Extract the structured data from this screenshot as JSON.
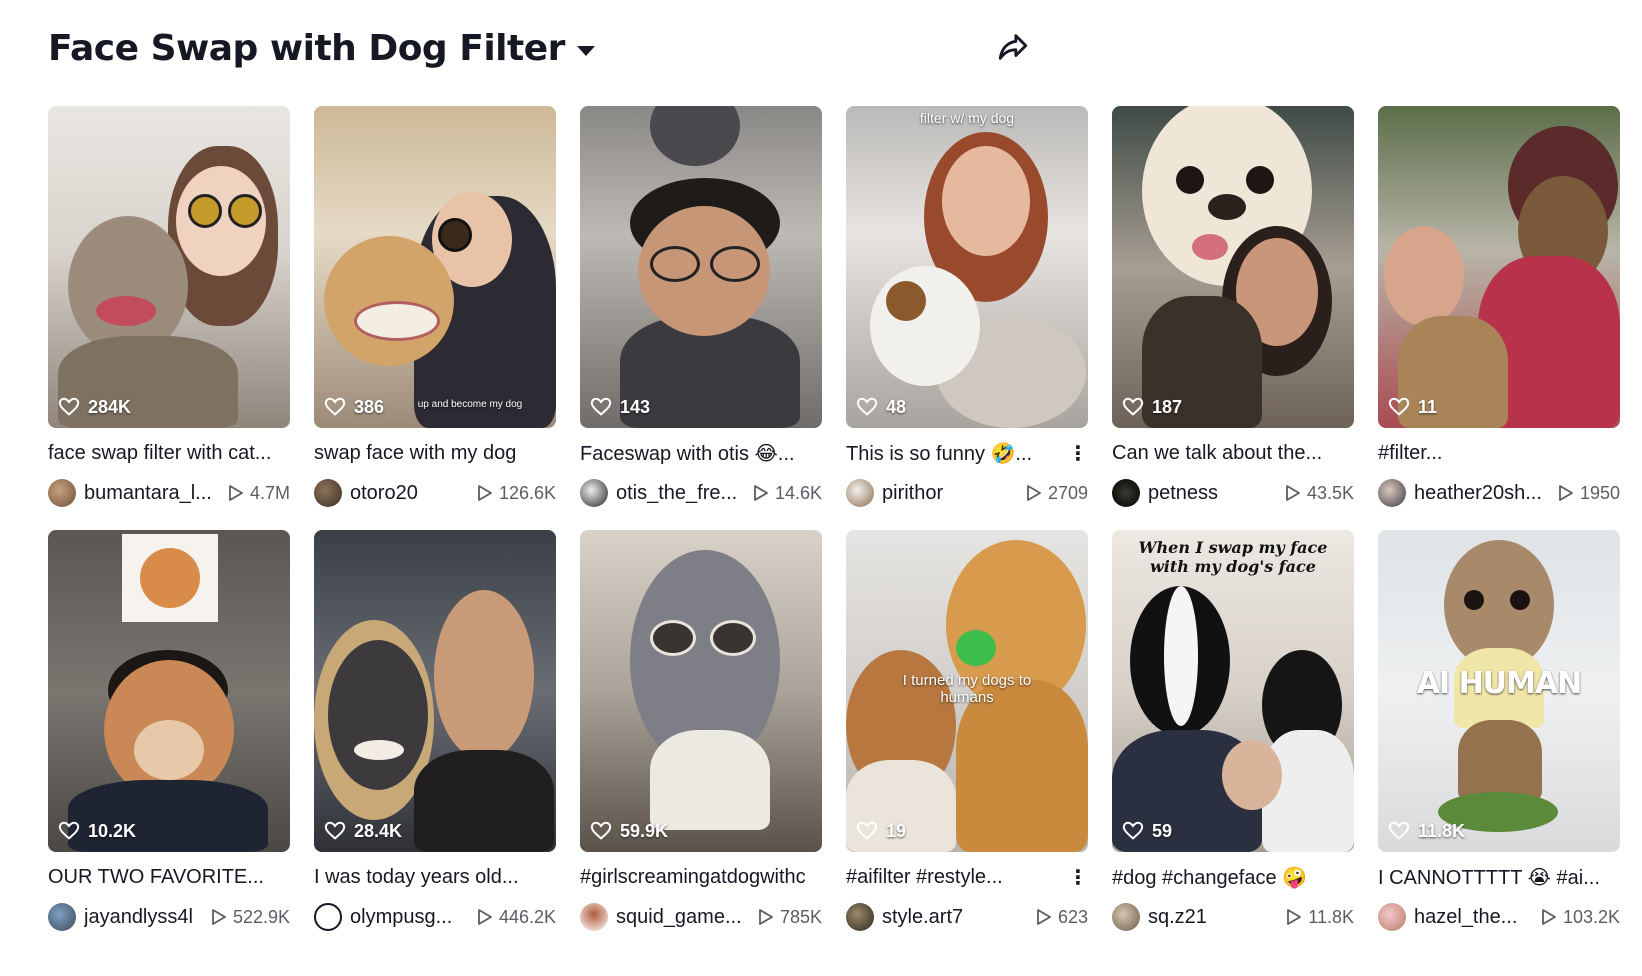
{
  "page": {
    "title": "Face Swap with Dog Filter"
  },
  "colors": {
    "text": "#161823",
    "secondary": "#5b5d66",
    "overlay_text": "#ffffff"
  },
  "icons": {
    "dropdown": "chevron-down-icon",
    "share": "share-arrow-icon",
    "likes": "heart-outline-icon",
    "plays": "play-outline-icon"
  },
  "videos": [
    {
      "likes": "284K",
      "caption": "face swap filter with cat...",
      "author": "bumantara_l...",
      "plays": "4.7M"
    },
    {
      "likes": "386",
      "caption": "swap face with my dog",
      "author": "otoro20",
      "plays": "126.6K",
      "overlay": "up and become my dog"
    },
    {
      "likes": "143",
      "caption": "Faceswap with otis 😂...",
      "author": "otis_the_fre...",
      "plays": "14.6K"
    },
    {
      "likes": "48",
      "caption": "This is so funny 🤣...",
      "author": "pirithor",
      "plays": "2709",
      "overlay": "filter w/ my dog",
      "more": "⋮"
    },
    {
      "likes": "187",
      "caption": "Can we talk about the...",
      "author": "petness",
      "plays": "43.5K"
    },
    {
      "likes": "11",
      "caption": "#filter...",
      "author": "heather20sh...",
      "plays": "1950"
    },
    {
      "likes": "10.2K",
      "caption": "OUR TWO FAVORITE...",
      "author": "jayandlyss4l",
      "plays": "522.9K"
    },
    {
      "likes": "28.4K",
      "caption": "I was today years old...",
      "author": "olympusg...",
      "plays": "446.2K"
    },
    {
      "likes": "59.9K",
      "caption": "#girlscreamingatdogwithc",
      "author": "squid_game...",
      "plays": "785K"
    },
    {
      "likes": "19",
      "caption": "#aifilter #restyle...",
      "author": "style.art7",
      "plays": "623",
      "overlay": "I turned my dogs to humans",
      "more": "⋮"
    },
    {
      "likes": "59",
      "caption": "#dog #changeface 🤪",
      "author": "sq.z21",
      "plays": "11.8K",
      "overlay": "When I swap my face with my dog's face"
    },
    {
      "likes": "11.8K",
      "caption": "I CANNOTTTTT 😭 #ai...",
      "author": "hazel_the...",
      "plays": "103.2K",
      "overlay": "AI HUMAN"
    }
  ]
}
